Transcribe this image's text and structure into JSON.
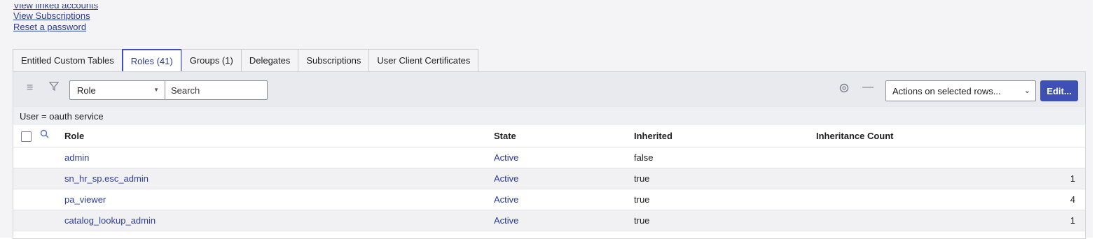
{
  "top_links": {
    "linked_accounts": "View linked accounts",
    "subscriptions": "View Subscriptions",
    "reset_password": "Reset a password"
  },
  "tabs": [
    {
      "label": "Entitled Custom Tables"
    },
    {
      "label": "Roles (41)"
    },
    {
      "label": "Groups (1)"
    },
    {
      "label": "Delegates"
    },
    {
      "label": "Subscriptions"
    },
    {
      "label": "User Client Certificates"
    }
  ],
  "toolbar": {
    "field_select": "Role",
    "search_placeholder": "Search",
    "actions_select": "Actions on selected rows...",
    "edit_label": "Edit..."
  },
  "filter": "User = oauth service",
  "table": {
    "headers": {
      "role": "Role",
      "state": "State",
      "inherited": "Inherited",
      "count": "Inheritance Count"
    },
    "rows": [
      {
        "role": "admin",
        "state": "Active",
        "inherited": "false",
        "count": ""
      },
      {
        "role": "sn_hr_sp.esc_admin",
        "state": "Active",
        "inherited": "true",
        "count": "1"
      },
      {
        "role": "pa_viewer",
        "state": "Active",
        "inherited": "true",
        "count": "4"
      },
      {
        "role": "catalog_lookup_admin",
        "state": "Active",
        "inherited": "true",
        "count": "1"
      }
    ]
  },
  "colors": {
    "accent": "#3e4fb6",
    "link": "#2c3ca0",
    "toolbar_bg": "#e9eaee"
  }
}
